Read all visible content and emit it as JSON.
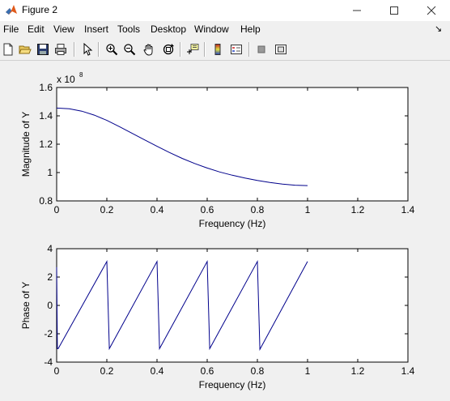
{
  "window": {
    "title": "Figure 2"
  },
  "menu": {
    "items": [
      "File",
      "Edit",
      "View",
      "Insert",
      "Tools",
      "Desktop",
      "Window",
      "Help"
    ],
    "overflow_arrow": "↘"
  },
  "toolbar": {
    "icons": [
      "new-figure-icon",
      "open-file-icon",
      "save-icon",
      "print-icon",
      "edit-plot-icon",
      "zoom-in-icon",
      "zoom-out-icon",
      "pan-hand-icon",
      "rotate-3d-icon",
      "data-cursor-icon",
      "insert-colorbar-icon",
      "insert-legend-icon",
      "hide-plot-tools-icon",
      "show-plot-tools-icon"
    ]
  },
  "chart_data": [
    {
      "type": "line",
      "xlabel": "Frequency (Hz)",
      "ylabel": "Magnitude of Y",
      "exponent_label": "x 10",
      "exponent_power": "8",
      "xlim": [
        0,
        1.4
      ],
      "ylim": [
        0.8,
        1.6
      ],
      "xticks": [
        "0",
        "0.2",
        "0.4",
        "0.6",
        "0.8",
        "1",
        "1.2",
        "1.4"
      ],
      "yticks": [
        "0.8",
        "1",
        "1.2",
        "1.4",
        "1.6"
      ],
      "line_color": "#00008b",
      "grid": false,
      "series": [
        {
          "x": [
            0,
            0.05,
            0.1,
            0.15,
            0.2,
            0.25,
            0.3,
            0.35,
            0.4,
            0.45,
            0.5,
            0.55,
            0.6,
            0.65,
            0.7,
            0.75,
            0.8,
            0.85,
            0.9,
            0.95,
            1.0
          ],
          "values": [
            1.455,
            1.45,
            1.433,
            1.405,
            1.368,
            1.324,
            1.278,
            1.231,
            1.185,
            1.141,
            1.1,
            1.064,
            1.032,
            1.004,
            0.981,
            0.961,
            0.944,
            0.93,
            0.919,
            0.911,
            0.908
          ]
        }
      ]
    },
    {
      "type": "line",
      "xlabel": "Frequency (Hz)",
      "ylabel": "Phase of Y",
      "xlim": [
        0,
        1.4
      ],
      "ylim": [
        -4,
        4
      ],
      "xticks": [
        "0",
        "0.2",
        "0.4",
        "0.6",
        "0.8",
        "1",
        "1.2",
        "1.4"
      ],
      "yticks": [
        "-4",
        "-2",
        "0",
        "2",
        "4"
      ],
      "line_color": "#00008b",
      "grid": false,
      "series": [
        {
          "x": [
            0,
            0.003,
            0.006,
            0.2,
            0.21,
            0.4,
            0.41,
            0.6,
            0.61,
            0.8,
            0.81,
            1.0
          ],
          "values": [
            2.7,
            -3.05,
            -3.05,
            3.1,
            -3.05,
            3.1,
            -3.05,
            3.1,
            -3.05,
            3.1,
            -3.1,
            3.1
          ]
        }
      ]
    }
  ]
}
